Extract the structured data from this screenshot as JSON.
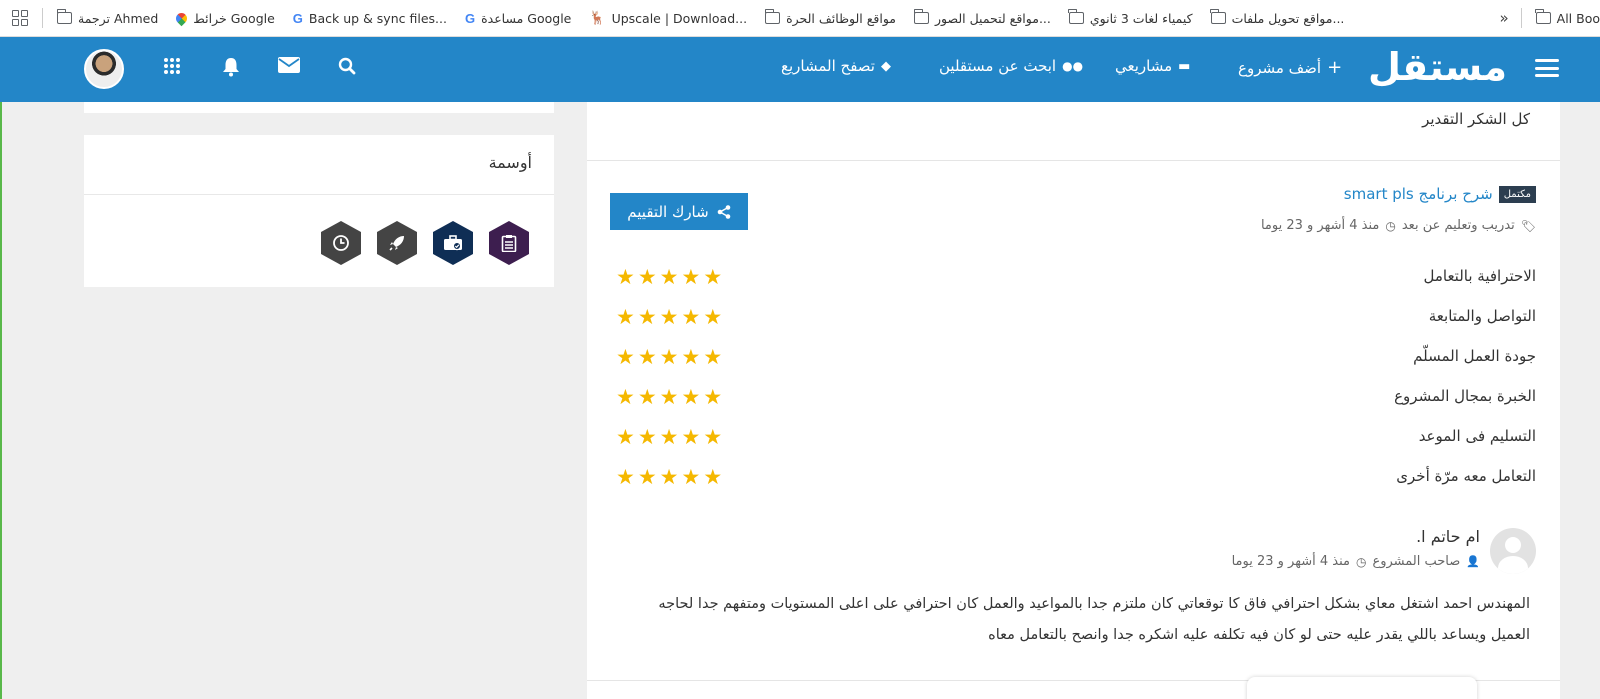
{
  "bookmarks": {
    "items_left": [
      {
        "label": "ترجمة Ahmed",
        "icon": "folder-icon"
      },
      {
        "label": "خرائط Google",
        "icon": "maps-pin-icon"
      },
      {
        "label": "Back up & sync files...",
        "icon": "google-icon"
      },
      {
        "label": "مساعدة Google",
        "icon": "google-icon"
      },
      {
        "label": "Upscale | Download...",
        "icon": "upscale-icon"
      },
      {
        "label": "مواقع الوظائف الحرة",
        "icon": "folder-icon"
      },
      {
        "label": "مواقع لتحميل الصور...",
        "icon": "folder-icon"
      },
      {
        "label": "كيمياء لغات 3 ثانوي",
        "icon": "folder-icon"
      },
      {
        "label": "مواقع تحويل ملفات...",
        "icon": "folder-icon"
      }
    ],
    "overflow": "»",
    "all_bookmarks": "All Boo"
  },
  "nav": {
    "logo": "مستقل",
    "links": {
      "add_project": "أضف مشروع",
      "my_projects": "مشاريعي",
      "find_freelancers": "ابحث عن مستقلين",
      "browse_projects": "تصفح المشاريع"
    },
    "colors": {
      "primary": "#2386c8"
    }
  },
  "sidebar": {
    "badges_title": "أوسمة",
    "badges": [
      {
        "icon": "clipboard-icon",
        "color": "#3d1e4f"
      },
      {
        "icon": "briefcase-check-icon",
        "color": "#0f2e55"
      },
      {
        "icon": "rocket-icon",
        "color": "#444444"
      },
      {
        "icon": "clock-icon",
        "color": "#444444"
      }
    ]
  },
  "review": {
    "previous_text": "كل الشكر التقدير",
    "project_status": "مكتمل",
    "project_title": "شرح برنامج smart pls",
    "category": "تدريب وتعليم عن بعد",
    "time_ago": "منذ 4 أشهر و 23 يوما",
    "share_button": "شارك التقييم",
    "ratings": [
      {
        "label": "الاحترافية بالتعامل",
        "stars": 5
      },
      {
        "label": "التواصل والمتابعة",
        "stars": 5
      },
      {
        "label": "جودة العمل المسلّم",
        "stars": 5
      },
      {
        "label": "الخبرة بمجال المشروع",
        "stars": 5
      },
      {
        "label": "التسليم فى الموعد",
        "stars": 5
      },
      {
        "label": "التعامل معه مرّة أخرى",
        "stars": 5
      }
    ],
    "reviewer_name": "ام حاتم ا.",
    "reviewer_role": "صاحب المشروع",
    "reviewer_time": "منذ 4 أشهر و 23 يوما",
    "text": "المهندس احمد اشتغل معاي بشكل احترافي فاق كا توقعاتي كان ملتزم جدا بالمواعيد والعمل كان احترافي على اعلى المستويات ومتفهم جدا لحاجه العميل ويساعد باللي يقدر عليه حتى لو كان فيه تكلفه عليه اشكره جدا وانصح بالتعامل معاه"
  }
}
